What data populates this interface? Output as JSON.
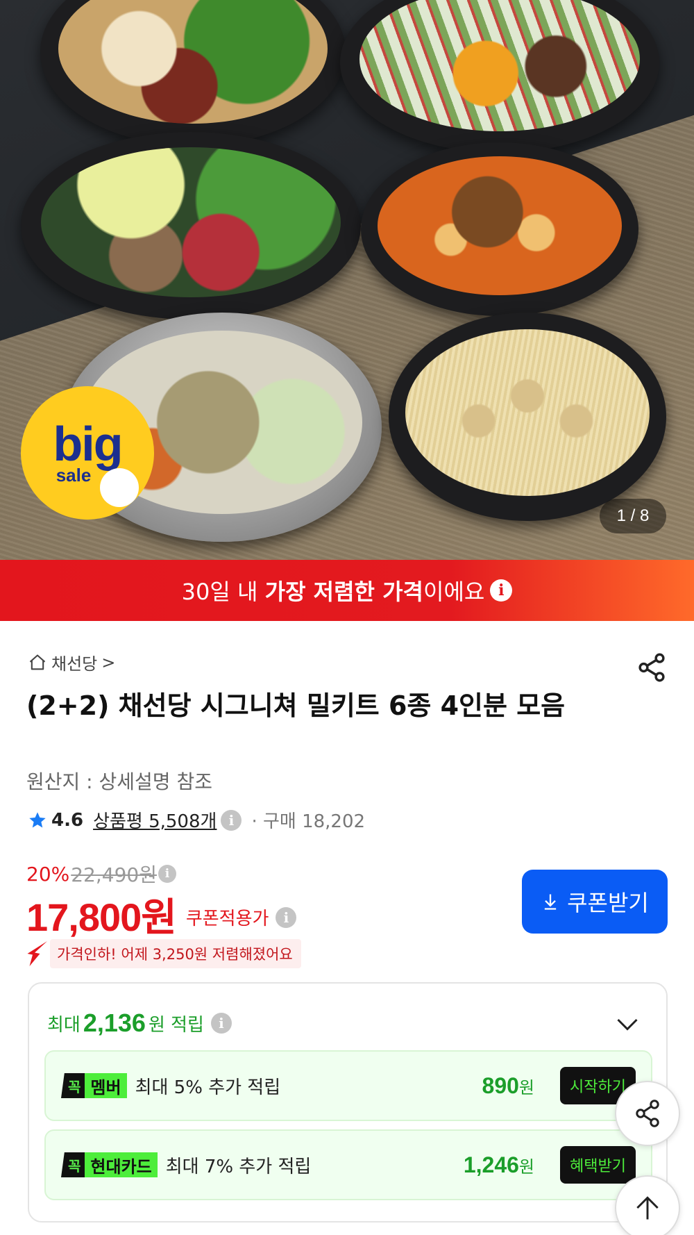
{
  "hero": {
    "badge_big": "big",
    "badge_sale": "sale",
    "image_counter": "1 / 8"
  },
  "banner": {
    "text_prefix": "30일 내 ",
    "text_bold": "가장 저렴한 가격",
    "text_suffix": "이에요",
    "info_icon": "i"
  },
  "product": {
    "shop_name": "채선당",
    "shop_chevron": ">",
    "title": "(2+2) 채선당 시그니쳐 밀키트 6종 4인분 모음",
    "origin": "원산지 : 상세설명 참조",
    "rating": "4.6",
    "reviews": "상품평 5,508개",
    "purchases": "· 구매 18,202"
  },
  "price": {
    "discount_pct": "20%",
    "original_price": "22,490원",
    "sale_price": "17,800원",
    "coupon_label": "쿠폰적용가",
    "coupon_button": "쿠폰받기",
    "price_drop": "가격인하! 어제 3,250원 저렴해졌어요"
  },
  "rewards": {
    "head_prefix": "최대",
    "head_amount": "2,136",
    "head_suffix": "원 적립",
    "rows": [
      {
        "tag": "꼭",
        "brand": "멤버",
        "desc": "최대 5% 추가 적립",
        "value": "890",
        "unit": "원",
        "action": "시작하기"
      },
      {
        "tag": "꼭",
        "brand": "현대카드",
        "desc": "최대 7% 추가 적립",
        "value": "1,246",
        "unit": "원",
        "action": "혜택받기"
      }
    ]
  },
  "colors": {
    "accent_red": "#e3161d",
    "accent_blue": "#0a5cf5",
    "reward_green": "#1b9e2a",
    "kkok_green": "#4ded3b"
  },
  "icons": [
    "home-icon",
    "share-icon",
    "star-icon",
    "info-icon",
    "download-icon",
    "price-drop-arrow-icon",
    "chevron-down-icon",
    "scroll-top-icon"
  ]
}
